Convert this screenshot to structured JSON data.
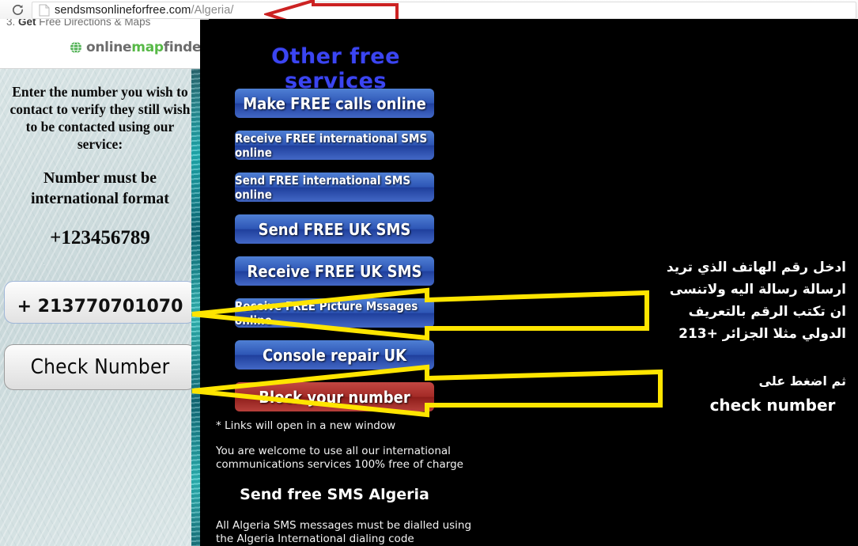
{
  "browser": {
    "reload_icon": "reload-icon",
    "page_icon": "page-document-icon",
    "url_host": "sendsmsonlineforfree.com",
    "url_path": "/Algeria/",
    "url_full": "sendsmsonlineforfree.com/Algeria/"
  },
  "ad": {
    "headline_number": "3. ",
    "headline_bold": "Get ",
    "headline_rest": "Free Directions & Maps",
    "logo_part1": "online",
    "logo_part2": "map",
    "logo_part3": "finder",
    "logo_tm": "˜",
    "globe_icon": "globe-icon"
  },
  "sidebar": {
    "intro": "Enter the number you wish to contact to verify they still wish to be contacted using our service:",
    "format_note": "Number must be international format",
    "example_number": "+123456789",
    "input_value": "+ 213770701070",
    "input_placeholder": "+123456789",
    "check_button_label": "Check Number"
  },
  "main": {
    "services_title": "Other free services",
    "buttons": [
      {
        "label": "Make FREE calls online",
        "color": "blue",
        "size": "f20"
      },
      {
        "label": "Receive FREE international SMS online",
        "color": "blue",
        "size": "f15"
      },
      {
        "label": "Send FREE international SMS online",
        "color": "blue",
        "size": "f15"
      },
      {
        "label": "Send FREE UK SMS",
        "color": "blue",
        "size": "f20"
      },
      {
        "label": "Receive FREE UK SMS",
        "color": "blue",
        "size": "f20"
      },
      {
        "label": "Receive FREE Picture Mssages online",
        "color": "blue",
        "size": "f15"
      },
      {
        "label": "Console repair UK",
        "color": "blue",
        "size": "f20"
      },
      {
        "label": "Block your number",
        "color": "red",
        "size": "f20"
      }
    ],
    "note_links": "* Links will open in a new window",
    "note_welcome_line1": "You are welcome to use all our international",
    "note_welcome_line2": "communications services 100% free of charge",
    "send_heading": "Send free SMS Algeria",
    "note_dial_line1": "All Algeria SMS messages must be dialled using",
    "note_dial_line2": "the Algeria International dialing code"
  },
  "annotations": {
    "arabic_instruction": "ادخل رقم الهاتف الذي تريد ارسالة رسالة اليه ولاتنسى ان تكتب الرقم بالتعريف الدولي مثلا الجزائر +213",
    "arabic_then_press": "ثم اضغط على",
    "check_number_label": "check number",
    "arrow_color_yellow": "#FFE500",
    "arrow_color_red": "#CC2222"
  }
}
